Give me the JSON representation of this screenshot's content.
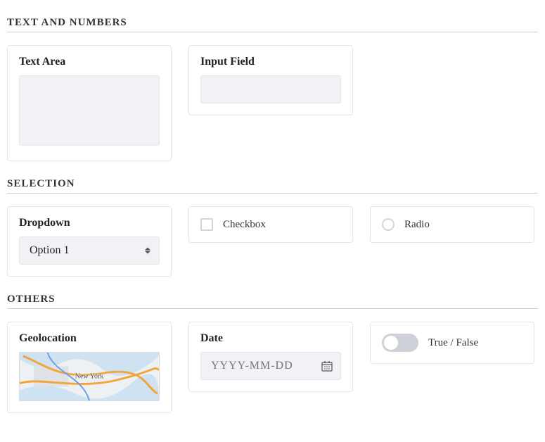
{
  "sections": {
    "text_numbers": {
      "title": "TEXT AND NUMBERS"
    },
    "selection": {
      "title": "SELECTION"
    },
    "others": {
      "title": "OTHERS"
    }
  },
  "textArea": {
    "label": "Text Area",
    "value": ""
  },
  "inputField": {
    "label": "Input Field",
    "value": ""
  },
  "dropdown": {
    "label": "Dropdown",
    "selected": "Option 1"
  },
  "checkbox": {
    "label": "Checkbox",
    "checked": false
  },
  "radio": {
    "label": "Radio",
    "selected": false
  },
  "geolocation": {
    "label": "Geolocation",
    "mapLabel": "New York"
  },
  "date": {
    "label": "Date",
    "placeholder": "YYYY-MM-DD",
    "value": ""
  },
  "toggle": {
    "label": "True / False",
    "value": false
  }
}
